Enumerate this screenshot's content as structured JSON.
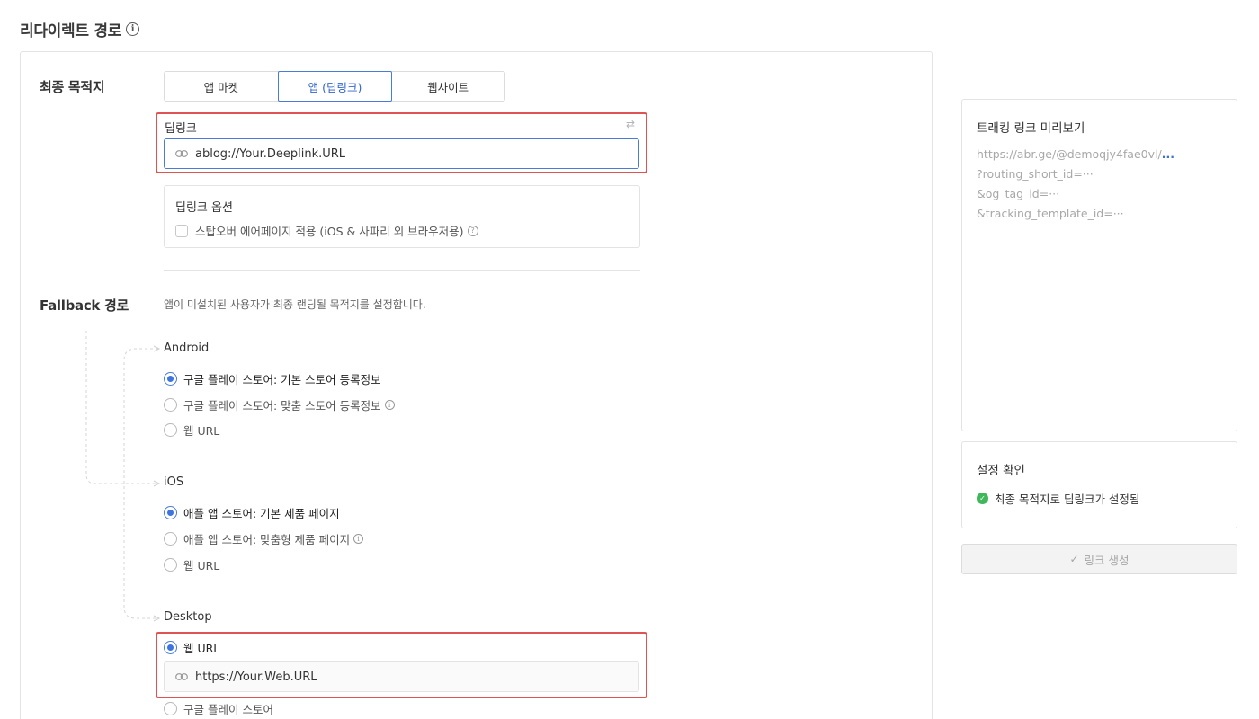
{
  "page": {
    "title": "리다이렉트 경로"
  },
  "destination": {
    "label": "최종 목적지",
    "tabs": [
      {
        "label": "앱 마켓",
        "active": false
      },
      {
        "label": "앱 (딥링크)",
        "active": true
      },
      {
        "label": "웹사이트",
        "active": false
      }
    ],
    "deeplink": {
      "label": "딥링크",
      "value": "ablog://Your.Deeplink.URL",
      "swap_icon": "swap-arrows-icon"
    },
    "options": {
      "title": "딥링크 옵션",
      "checkbox_label": "스탑오버 에어페이지 적용 (iOS & 사파리 외 브라우저용)",
      "checked": false
    }
  },
  "fallback": {
    "label": "Fallback 경로",
    "helper": "앱이 미설치된 사용자가 최종 랜딩될 목적지를 설정합니다.",
    "android": {
      "label": "Android",
      "options": [
        {
          "label": "구글 플레이 스토어: 기본 스토어 등록정보",
          "selected": true,
          "info": false
        },
        {
          "label": "구글 플레이 스토어: 맞춤 스토어 등록정보",
          "selected": false,
          "info": true
        },
        {
          "label": "웹 URL",
          "selected": false,
          "info": false
        }
      ]
    },
    "ios": {
      "label": "iOS",
      "options": [
        {
          "label": "애플 앱 스토어: 기본 제품 페이지",
          "selected": true,
          "info": false
        },
        {
          "label": "애플 앱 스토어: 맞춤형 제품 페이지",
          "selected": false,
          "info": true
        },
        {
          "label": "웹 URL",
          "selected": false,
          "info": false
        }
      ]
    },
    "desktop": {
      "label": "Desktop",
      "web_url_label": "웹 URL",
      "web_url_value": "https://Your.Web.URL",
      "other_option": "구글 플레이 스토어"
    }
  },
  "preview": {
    "title": "트래킹 링크 미리보기",
    "lines": [
      "https://abr.ge/@demoqjy4fae0vl/",
      "?routing_short_id=···",
      "&og_tag_id=···",
      "&tracking_template_id=···"
    ],
    "ellipsis": "..."
  },
  "confirm": {
    "title": "설정 확인",
    "status": "최종 목적지로 딥링크가 설정됨"
  },
  "create_button": {
    "label": "링크 생성",
    "check": "✓"
  },
  "colors": {
    "accent": "#3d74e0",
    "highlight": "#e05353",
    "success": "#3fb75b"
  }
}
